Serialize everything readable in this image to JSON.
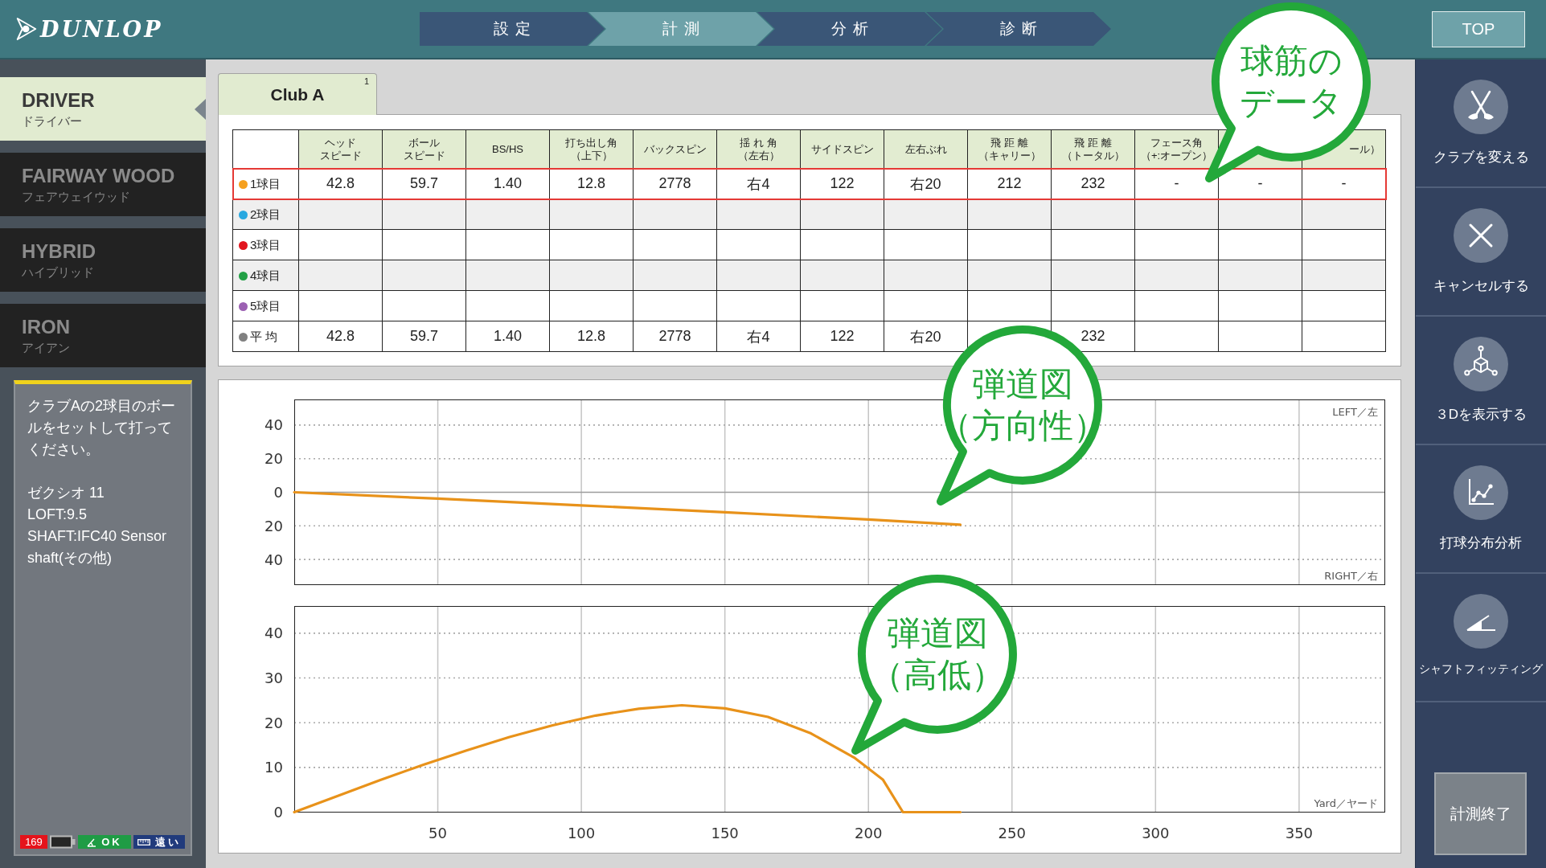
{
  "header": {
    "logo": "DUNLOP",
    "steps": [
      {
        "label": "設定",
        "selected": false
      },
      {
        "label": "計測",
        "selected": true
      },
      {
        "label": "分析",
        "selected": false
      },
      {
        "label": "診断",
        "selected": false
      }
    ],
    "top_button": "TOP"
  },
  "sidebar": {
    "club_types": [
      {
        "label": "DRIVER",
        "sublabel": "ドライバー",
        "selected": true
      },
      {
        "label": "FAIRWAY WOOD",
        "sublabel": "フェアウェイウッド",
        "selected": false
      },
      {
        "label": "HYBRID",
        "sublabel": "ハイブリッド",
        "selected": false
      },
      {
        "label": "IRON",
        "sublabel": "アイアン",
        "selected": false
      }
    ],
    "message": {
      "instruction": "クラブAの2球目のボールをセットして打ってください。",
      "details": [
        "ゼクシオ 11",
        "LOFT:9.5",
        "SHAFT:IFC40 Sensor shaft(その他)"
      ]
    },
    "status": [
      {
        "kind": "count",
        "text": "169"
      },
      {
        "kind": "battery"
      },
      {
        "kind": "angle",
        "text": "OK"
      },
      {
        "kind": "distance",
        "text": "遠い"
      }
    ]
  },
  "club_tab": {
    "label": "Club A",
    "count": "1"
  },
  "table": {
    "columns": [
      [
        "ヘッド",
        "スピード"
      ],
      [
        "ボール",
        "スピード"
      ],
      [
        "BS/HS"
      ],
      [
        "打ち出し角",
        "（上下）"
      ],
      [
        "バックスピン"
      ],
      [
        "揺 れ 角",
        "（左右）"
      ],
      [
        "サイドスピン"
      ],
      [
        "左右ぶれ"
      ],
      [
        "飛 距 離",
        "（キャリー）"
      ],
      [
        "飛 距 離",
        "（トータル）"
      ],
      [
        "フェース角",
        "（+:オープン）"
      ],
      null,
      [
        "ール）"
      ]
    ],
    "rows": [
      {
        "kind": "shot",
        "label": "1球目",
        "color": "#f5a01f",
        "selected": true,
        "cells": [
          "42.8",
          "59.7",
          "1.40",
          "12.8",
          "2778",
          "右4",
          "122",
          "右20",
          "212",
          "232",
          "-",
          "-",
          "-"
        ]
      },
      {
        "kind": "shot",
        "label": "2球目",
        "color": "#29a8e0",
        "selected": false
      },
      {
        "kind": "shot",
        "label": "3球目",
        "color": "#e2161f",
        "selected": false
      },
      {
        "kind": "shot",
        "label": "4球目",
        "color": "#22a045",
        "selected": false
      },
      {
        "kind": "shot",
        "label": "5球目",
        "color": "#9b60b2",
        "selected": false
      },
      {
        "kind": "average",
        "label": "平 均",
        "color": "#808080",
        "selected": false,
        "cells": [
          "42.8",
          "59.7",
          "1.40",
          "12.8",
          "2778",
          "右4",
          "122",
          "右20",
          null,
          "232",
          null,
          null,
          null
        ]
      }
    ]
  },
  "trajectory": {
    "direction_chart": {
      "chart_data": {
        "type": "line",
        "grid": true,
        "x": [
          0,
          50,
          100,
          150,
          200,
          232
        ],
        "series": [
          {
            "color": "#e8921a",
            "values": [
              0,
              -3.8,
              -7.8,
              -11.9,
              -16.2,
              -19.3
            ]
          }
        ],
        "xlim": [
          0,
          380
        ],
        "ylim": [
          -55,
          55
        ],
        "yticks": [
          {
            "value": 40,
            "label": "40"
          },
          {
            "value": 20,
            "label": "20"
          },
          0,
          {
            "value": -20,
            "label": "20"
          },
          {
            "value": -40,
            "label": "40"
          }
        ],
        "annotations": [
          "LEFT／左",
          "RIGHT／右"
        ]
      }
    },
    "height_chart": {
      "chart_data": {
        "type": "line",
        "grid": true,
        "xlabel": "Yard／ヤード",
        "x": [
          0,
          15,
          30,
          45,
          60,
          75,
          90,
          105,
          120,
          135,
          150,
          165,
          180,
          195,
          205,
          212,
          232
        ],
        "series": [
          {
            "color": "#e8921a",
            "values": [
              0,
              3.6,
              7.2,
              10.6,
              13.8,
              16.8,
              19.4,
              21.6,
              23.1,
              23.9,
              23.2,
              21.3,
              17.6,
              12.2,
              7.3,
              0,
              0
            ]
          }
        ],
        "xlim": [
          0,
          380
        ],
        "ylim": [
          0,
          46
        ],
        "xticks": [
          50,
          100,
          150,
          200,
          250,
          300,
          350
        ],
        "yticks": [
          0,
          10,
          20,
          30,
          40
        ]
      }
    }
  },
  "actions": [
    {
      "kind": "clubs",
      "label": "クラブを変える"
    },
    {
      "kind": "close",
      "label": "キャンセルする"
    },
    {
      "kind": "cube",
      "label": "３Dを表示する"
    },
    {
      "kind": "chart",
      "label": "打球分布分析"
    },
    {
      "kind": "angle",
      "label": "シャフトフィッティング"
    }
  ],
  "finish_button": "計測終了",
  "callouts": [
    {
      "lines": [
        "球筋の",
        "データ"
      ]
    },
    {
      "lines": [
        "弾道図",
        "（方向性）"
      ]
    },
    {
      "lines": [
        "弾道図",
        "（高低）"
      ]
    }
  ]
}
